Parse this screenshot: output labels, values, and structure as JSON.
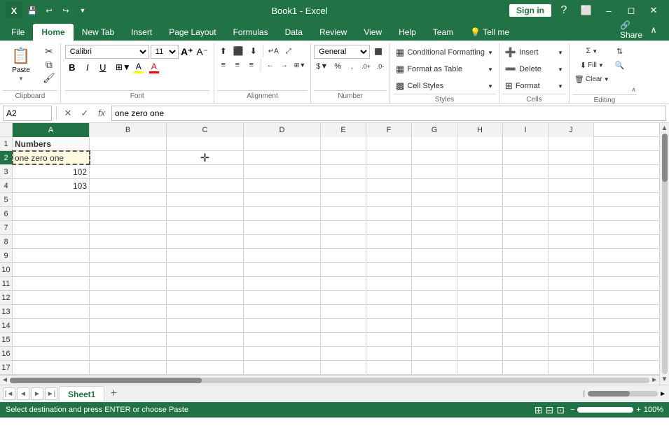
{
  "titleBar": {
    "title": "Book1 - Excel",
    "quickAccess": [
      "save",
      "undo",
      "redo",
      "customize"
    ],
    "signIn": "Sign in",
    "winControls": [
      "minimize",
      "restore",
      "close"
    ]
  },
  "ribbonTabs": {
    "tabs": [
      "File",
      "Home",
      "New Tab",
      "Insert",
      "Page Layout",
      "Formulas",
      "Data",
      "Review",
      "View",
      "Help",
      "Team",
      "Tell me"
    ],
    "activeTab": "Home"
  },
  "ribbon": {
    "clipboard": {
      "label": "Clipboard",
      "paste": "Paste",
      "cut": "✂",
      "copy": "⧉",
      "formatPainter": "🖌"
    },
    "font": {
      "label": "Font",
      "fontName": "Calibri",
      "fontSize": "11",
      "bold": "B",
      "italic": "I",
      "underline": "U",
      "borderBtn": "⊞",
      "fillColor": "A",
      "fontColor": "A",
      "increaseFont": "A",
      "decreaseFont": "A"
    },
    "alignment": {
      "label": "Alignment",
      "expandBtn": "⊞"
    },
    "number": {
      "label": "Number",
      "format": "General",
      "expandBtn": "⊞"
    },
    "styles": {
      "label": "Styles",
      "conditionalFormatting": "Conditional Formatting",
      "formatAsTable": "Format as Table",
      "cellStyles": "Cell Styles"
    },
    "cells": {
      "label": "Cells",
      "insert": "Insert",
      "delete": "Delete",
      "format": "Format"
    },
    "editing": {
      "label": "Editing",
      "sum": "Σ",
      "fill": "⬇",
      "clear": "🗑",
      "sort": "⇅",
      "find": "🔍",
      "collapseBtn": "∧"
    }
  },
  "formulaBar": {
    "cellRef": "A2",
    "cancel": "✕",
    "confirm": "✓",
    "fx": "fx",
    "formula": "one zero one"
  },
  "spreadsheet": {
    "columns": [
      "A",
      "B",
      "C",
      "D",
      "E",
      "F",
      "G",
      "H",
      "I",
      "J"
    ],
    "rows": [
      {
        "rowNum": 1,
        "cells": [
          {
            "value": "Numbers",
            "style": "bold header"
          },
          "",
          "",
          "",
          "",
          "",
          "",
          "",
          "",
          ""
        ]
      },
      {
        "rowNum": 2,
        "cells": [
          {
            "value": "one zero one",
            "style": "selected yellow"
          },
          "",
          "",
          "",
          "",
          "",
          "",
          "",
          "",
          ""
        ]
      },
      {
        "rowNum": 3,
        "cells": [
          {
            "value": "102",
            "align": "right"
          },
          "",
          "",
          "",
          "",
          "",
          "",
          "",
          "",
          ""
        ]
      },
      {
        "rowNum": 4,
        "cells": [
          {
            "value": "103",
            "align": "right"
          },
          "",
          "",
          "",
          "",
          "",
          "",
          "",
          "",
          ""
        ]
      },
      {
        "rowNum": 5,
        "cells": [
          "",
          "",
          "",
          "",
          "",
          "",
          "",
          "",
          "",
          ""
        ]
      },
      {
        "rowNum": 6,
        "cells": [
          "",
          "",
          "",
          "",
          "",
          "",
          "",
          "",
          "",
          ""
        ]
      },
      {
        "rowNum": 7,
        "cells": [
          "",
          "",
          "",
          "",
          "",
          "",
          "",
          "",
          "",
          ""
        ]
      },
      {
        "rowNum": 8,
        "cells": [
          "",
          "",
          "",
          "",
          "",
          "",
          "",
          "",
          "",
          ""
        ]
      },
      {
        "rowNum": 9,
        "cells": [
          "",
          "",
          "",
          "",
          "",
          "",
          "",
          "",
          "",
          ""
        ]
      },
      {
        "rowNum": 10,
        "cells": [
          "",
          "",
          "",
          "",
          "",
          "",
          "",
          "",
          "",
          ""
        ]
      },
      {
        "rowNum": 11,
        "cells": [
          "",
          "",
          "",
          "",
          "",
          "",
          "",
          "",
          "",
          ""
        ]
      },
      {
        "rowNum": 12,
        "cells": [
          "",
          "",
          "",
          "",
          "",
          "",
          "",
          "",
          "",
          ""
        ]
      },
      {
        "rowNum": 13,
        "cells": [
          "",
          "",
          "",
          "",
          "",
          "",
          "",
          "",
          "",
          ""
        ]
      },
      {
        "rowNum": 14,
        "cells": [
          "",
          "",
          "",
          "",
          "",
          "",
          "",
          "",
          "",
          ""
        ]
      },
      {
        "rowNum": 15,
        "cells": [
          "",
          "",
          "",
          "",
          "",
          "",
          "",
          "",
          "",
          ""
        ]
      },
      {
        "rowNum": 16,
        "cells": [
          "",
          "",
          "",
          "",
          "",
          "",
          "",
          "",
          "",
          ""
        ]
      },
      {
        "rowNum": 17,
        "cells": [
          "",
          "",
          "",
          "",
          "",
          "",
          "",
          "",
          "",
          ""
        ]
      }
    ]
  },
  "sheetTabs": {
    "tabs": [
      "Sheet1"
    ],
    "activeTab": "Sheet1",
    "addLabel": "+"
  },
  "statusBar": {
    "message": "Select destination and press ENTER or choose Paste",
    "cellMode": "⊞",
    "layoutMode": "⊟",
    "pageLayout": "⊡",
    "zoom": "100%",
    "zoomSlider": 100
  }
}
